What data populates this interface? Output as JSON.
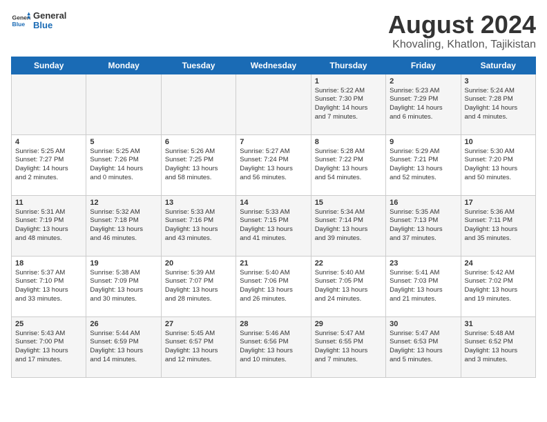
{
  "header": {
    "logo_general": "General",
    "logo_blue": "Blue",
    "title": "August 2024",
    "subtitle": "Khovaling, Khatlon, Tajikistan"
  },
  "days_of_week": [
    "Sunday",
    "Monday",
    "Tuesday",
    "Wednesday",
    "Thursday",
    "Friday",
    "Saturday"
  ],
  "weeks": [
    [
      {
        "day": "",
        "info": ""
      },
      {
        "day": "",
        "info": ""
      },
      {
        "day": "",
        "info": ""
      },
      {
        "day": "",
        "info": ""
      },
      {
        "day": "1",
        "info": "Sunrise: 5:22 AM\nSunset: 7:30 PM\nDaylight: 14 hours\nand 7 minutes."
      },
      {
        "day": "2",
        "info": "Sunrise: 5:23 AM\nSunset: 7:29 PM\nDaylight: 14 hours\nand 6 minutes."
      },
      {
        "day": "3",
        "info": "Sunrise: 5:24 AM\nSunset: 7:28 PM\nDaylight: 14 hours\nand 4 minutes."
      }
    ],
    [
      {
        "day": "4",
        "info": "Sunrise: 5:25 AM\nSunset: 7:27 PM\nDaylight: 14 hours\nand 2 minutes."
      },
      {
        "day": "5",
        "info": "Sunrise: 5:25 AM\nSunset: 7:26 PM\nDaylight: 14 hours\nand 0 minutes."
      },
      {
        "day": "6",
        "info": "Sunrise: 5:26 AM\nSunset: 7:25 PM\nDaylight: 13 hours\nand 58 minutes."
      },
      {
        "day": "7",
        "info": "Sunrise: 5:27 AM\nSunset: 7:24 PM\nDaylight: 13 hours\nand 56 minutes."
      },
      {
        "day": "8",
        "info": "Sunrise: 5:28 AM\nSunset: 7:22 PM\nDaylight: 13 hours\nand 54 minutes."
      },
      {
        "day": "9",
        "info": "Sunrise: 5:29 AM\nSunset: 7:21 PM\nDaylight: 13 hours\nand 52 minutes."
      },
      {
        "day": "10",
        "info": "Sunrise: 5:30 AM\nSunset: 7:20 PM\nDaylight: 13 hours\nand 50 minutes."
      }
    ],
    [
      {
        "day": "11",
        "info": "Sunrise: 5:31 AM\nSunset: 7:19 PM\nDaylight: 13 hours\nand 48 minutes."
      },
      {
        "day": "12",
        "info": "Sunrise: 5:32 AM\nSunset: 7:18 PM\nDaylight: 13 hours\nand 46 minutes."
      },
      {
        "day": "13",
        "info": "Sunrise: 5:33 AM\nSunset: 7:16 PM\nDaylight: 13 hours\nand 43 minutes."
      },
      {
        "day": "14",
        "info": "Sunrise: 5:33 AM\nSunset: 7:15 PM\nDaylight: 13 hours\nand 41 minutes."
      },
      {
        "day": "15",
        "info": "Sunrise: 5:34 AM\nSunset: 7:14 PM\nDaylight: 13 hours\nand 39 minutes."
      },
      {
        "day": "16",
        "info": "Sunrise: 5:35 AM\nSunset: 7:13 PM\nDaylight: 13 hours\nand 37 minutes."
      },
      {
        "day": "17",
        "info": "Sunrise: 5:36 AM\nSunset: 7:11 PM\nDaylight: 13 hours\nand 35 minutes."
      }
    ],
    [
      {
        "day": "18",
        "info": "Sunrise: 5:37 AM\nSunset: 7:10 PM\nDaylight: 13 hours\nand 33 minutes."
      },
      {
        "day": "19",
        "info": "Sunrise: 5:38 AM\nSunset: 7:09 PM\nDaylight: 13 hours\nand 30 minutes."
      },
      {
        "day": "20",
        "info": "Sunrise: 5:39 AM\nSunset: 7:07 PM\nDaylight: 13 hours\nand 28 minutes."
      },
      {
        "day": "21",
        "info": "Sunrise: 5:40 AM\nSunset: 7:06 PM\nDaylight: 13 hours\nand 26 minutes."
      },
      {
        "day": "22",
        "info": "Sunrise: 5:40 AM\nSunset: 7:05 PM\nDaylight: 13 hours\nand 24 minutes."
      },
      {
        "day": "23",
        "info": "Sunrise: 5:41 AM\nSunset: 7:03 PM\nDaylight: 13 hours\nand 21 minutes."
      },
      {
        "day": "24",
        "info": "Sunrise: 5:42 AM\nSunset: 7:02 PM\nDaylight: 13 hours\nand 19 minutes."
      }
    ],
    [
      {
        "day": "25",
        "info": "Sunrise: 5:43 AM\nSunset: 7:00 PM\nDaylight: 13 hours\nand 17 minutes."
      },
      {
        "day": "26",
        "info": "Sunrise: 5:44 AM\nSunset: 6:59 PM\nDaylight: 13 hours\nand 14 minutes."
      },
      {
        "day": "27",
        "info": "Sunrise: 5:45 AM\nSunset: 6:57 PM\nDaylight: 13 hours\nand 12 minutes."
      },
      {
        "day": "28",
        "info": "Sunrise: 5:46 AM\nSunset: 6:56 PM\nDaylight: 13 hours\nand 10 minutes."
      },
      {
        "day": "29",
        "info": "Sunrise: 5:47 AM\nSunset: 6:55 PM\nDaylight: 13 hours\nand 7 minutes."
      },
      {
        "day": "30",
        "info": "Sunrise: 5:47 AM\nSunset: 6:53 PM\nDaylight: 13 hours\nand 5 minutes."
      },
      {
        "day": "31",
        "info": "Sunrise: 5:48 AM\nSunset: 6:52 PM\nDaylight: 13 hours\nand 3 minutes."
      }
    ]
  ]
}
